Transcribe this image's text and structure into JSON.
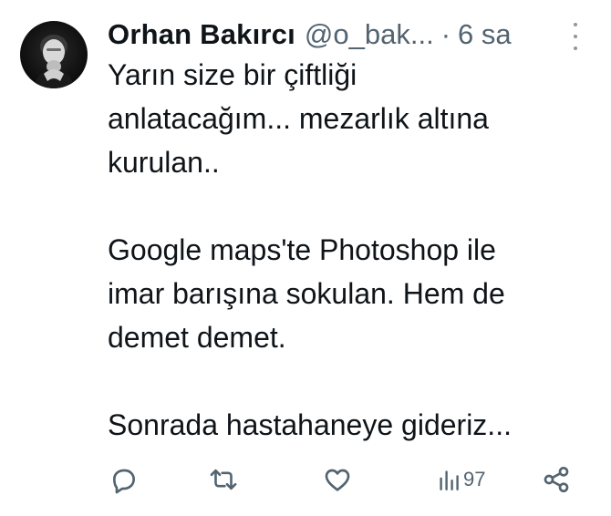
{
  "tweet": {
    "display_name": "Orhan Bakırcı",
    "handle": "@o_bak...",
    "separator": "·",
    "time": "6 sa",
    "paragraphs": [
      {
        "lines": [
          "Yarın size bir çiftliği",
          "anlatacağım... mezarlık altına",
          "kurulan.."
        ]
      },
      {
        "lines": [
          "Google maps'te Photoshop ile",
          "imar barışına sokulan. Hem de",
          "demet demet."
        ]
      },
      {
        "lines": [
          "Sonrada hastahaneye gideriz..."
        ]
      }
    ],
    "actions": {
      "reply_icon": "reply-icon",
      "retweet_icon": "retweet-icon",
      "like_icon": "heart-icon",
      "views_icon": "views-icon",
      "views_count": "97",
      "share_icon": "share-icon"
    }
  },
  "colors": {
    "text": "#0f1419",
    "secondary": "#536471",
    "background": "#ffffff"
  }
}
